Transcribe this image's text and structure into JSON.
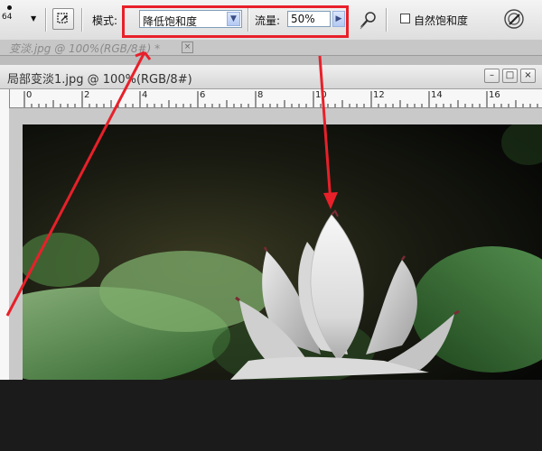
{
  "options_bar": {
    "brush_size": "64",
    "mode_label": "模式:",
    "mode_value": "降低饱和度",
    "flow_label": "流量:",
    "flow_value": "50%",
    "vibrance_label": "自然饱和度",
    "vibrance_checked": false
  },
  "tabs": {
    "inactive_title": "变淡.jpg @ 100%(RGB/8#) *",
    "close_glyph": "×"
  },
  "document": {
    "title": "局部变淡1.jpg @ 100%(RGB/8#)",
    "window_controls": {
      "minimize": "–",
      "restore": "□",
      "close": "×"
    },
    "ruler_labels": [
      "0",
      "2",
      "4",
      "6",
      "8",
      "10",
      "12",
      "14",
      "16"
    ]
  },
  "colors": {
    "annotation_red": "#e8202a",
    "dark_background": "#1b1b1b",
    "toolbar_bg": "#e8e8e8"
  },
  "icons": [
    "brush-preset-icon",
    "airbrush-icon",
    "chevron-down-icon",
    "arrow-right-icon",
    "tablet-pressure-icon",
    "brush-pressure-icon"
  ]
}
